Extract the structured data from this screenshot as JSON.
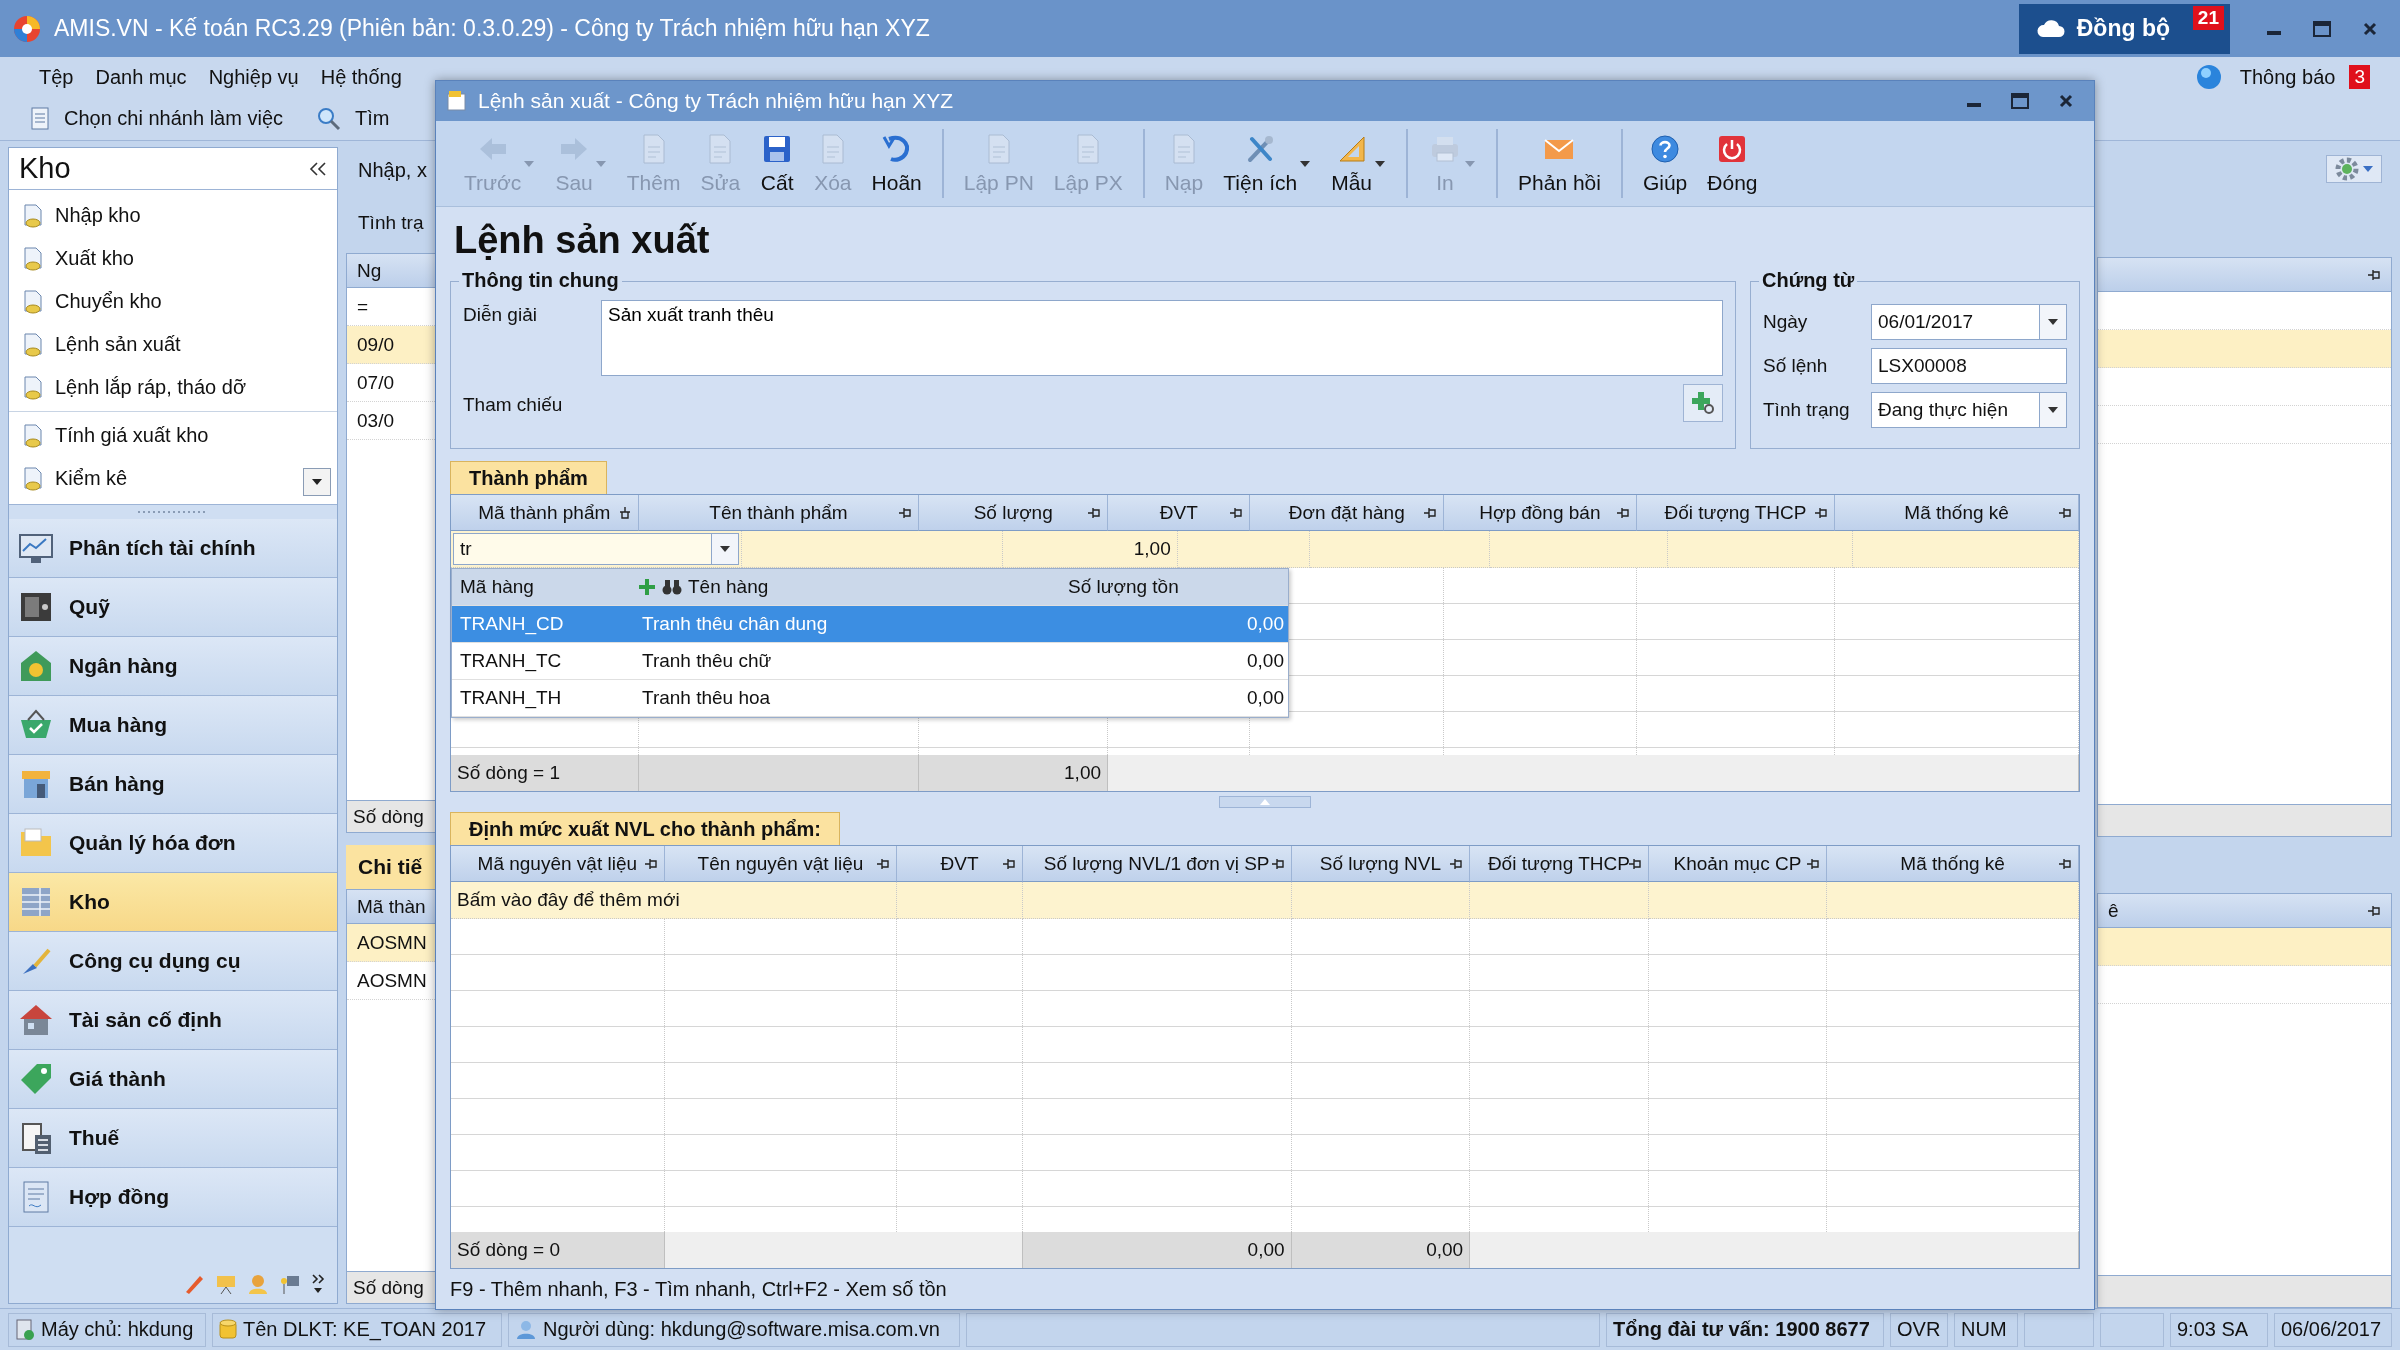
{
  "app": {
    "title": "AMIS.VN - Kế toán RC3.29 (Phiên bản: 0.3.0.29) - Công ty Trách nhiệm hữu hạn XYZ",
    "sync": {
      "label": "Đồng bộ",
      "count": "21"
    }
  },
  "menu": [
    "Tệp",
    "Danh mục",
    "Nghiệp vụ",
    "Hệ thống"
  ],
  "notice": {
    "label": "Thông báo",
    "count": "3"
  },
  "toolbar": [
    {
      "label": "Chọn chi nhánh làm việc",
      "kind": "branch"
    },
    {
      "label": "Tìm",
      "kind": "search"
    }
  ],
  "sidebar": {
    "title": "Kho",
    "item_groups": [
      [
        "Nhập kho",
        "Xuất kho",
        "Chuyển kho",
        "Lệnh sản xuất",
        "Lệnh lắp ráp, tháo dỡ"
      ],
      [
        "Tính giá xuất kho",
        "Kiểm kê"
      ]
    ],
    "modules": [
      {
        "label": "Phân tích tài chính",
        "kind": "chart",
        "selected": false
      },
      {
        "label": "Quỹ",
        "kind": "safe",
        "selected": false
      },
      {
        "label": "Ngân hàng",
        "kind": "bank",
        "selected": false
      },
      {
        "label": "Mua hàng",
        "kind": "cart",
        "selected": false
      },
      {
        "label": "Bán hàng",
        "kind": "shop",
        "selected": false
      },
      {
        "label": "Quản lý hóa đơn",
        "kind": "folder",
        "selected": false
      },
      {
        "label": "Kho",
        "kind": "warehouse",
        "selected": true
      },
      {
        "label": "Công cụ dụng cụ",
        "kind": "tool",
        "selected": false
      },
      {
        "label": "Tài sản cố định",
        "kind": "house",
        "selected": false
      },
      {
        "label": "Giá thành",
        "kind": "tag",
        "selected": false
      },
      {
        "label": "Thuế",
        "kind": "calculator",
        "selected": false
      },
      {
        "label": "Hợp đồng",
        "kind": "contract",
        "selected": false
      }
    ]
  },
  "background": {
    "tab": "Nhập, x",
    "status_label": "Tình trạ",
    "list_header": "Ng",
    "filter": "=",
    "list_rows": [
      {
        "text": "09/0",
        "selected": true
      },
      {
        "text": "07/0",
        "selected": false
      },
      {
        "text": "03/0",
        "selected": false
      }
    ],
    "list_footer": "Số dòng",
    "detail_tab": "Chi tiế",
    "detail_header": "Mã thàn",
    "detail_rows": [
      {
        "text": "AOSMN",
        "selected": true
      },
      {
        "text": "AOSMN",
        "selected": false
      }
    ],
    "detail_footer": "Số dòng",
    "right_detail_header": "ê"
  },
  "dialog": {
    "title": "Lệnh sản xuất - Công ty Trách nhiệm hữu hạn XYZ",
    "toolbar_groups": [
      [
        {
          "label": "Trước",
          "kind": "back",
          "disabled": true,
          "dropdown": true
        },
        {
          "label": "Sau",
          "kind": "forward",
          "disabled": true,
          "dropdown": true
        },
        {
          "label": "Thêm",
          "kind": "page",
          "disabled": true,
          "dropdown": false
        },
        {
          "label": "Sửa",
          "kind": "page",
          "disabled": true,
          "dropdown": false
        },
        {
          "label": "Cất",
          "kind": "save",
          "disabled": false,
          "dropdown": false
        },
        {
          "label": "Xóa",
          "kind": "page",
          "disabled": true,
          "dropdown": false
        },
        {
          "label": "Hoãn",
          "kind": "undo",
          "disabled": false,
          "dropdown": false
        }
      ],
      [
        {
          "label": "Lập PN",
          "kind": "page",
          "disabled": true,
          "dropdown": false
        },
        {
          "label": "Lập PX",
          "kind": "page",
          "disabled": true,
          "dropdown": false
        }
      ],
      [
        {
          "label": "Nạp",
          "kind": "page",
          "disabled": true,
          "dropdown": false
        },
        {
          "label": "Tiện ích",
          "kind": "tools",
          "disabled": false,
          "dropdown": true
        },
        {
          "label": "Mẫu",
          "kind": "ruler",
          "disabled": false,
          "dropdown": true
        }
      ],
      [
        {
          "label": "In",
          "kind": "print",
          "disabled": true,
          "dropdown": true
        }
      ],
      [
        {
          "label": "Phản hồi",
          "kind": "mail",
          "disabled": false,
          "dropdown": false
        }
      ],
      [
        {
          "label": "Giúp",
          "kind": "help",
          "disabled": false,
          "dropdown": false
        },
        {
          "label": "Đóng",
          "kind": "power",
          "disabled": false,
          "dropdown": false
        }
      ]
    ],
    "heading": "Lệnh sản xuất",
    "general": {
      "legend": "Thông tin chung",
      "description_label": "Diễn giải",
      "description": "Sản xuất tranh thêu",
      "reference_label": "Tham chiếu"
    },
    "voucher": {
      "legend": "Chứng từ",
      "fields": [
        {
          "label": "Ngày",
          "value": "06/01/2017",
          "kind": "combo"
        },
        {
          "label": "Số lệnh",
          "value": "LSX00008",
          "kind": "text"
        },
        {
          "label": "Tình trạng",
          "value": "Đang thực hiện",
          "kind": "combo"
        }
      ]
    },
    "products": {
      "tab": "Thành phẩm",
      "columns": [
        {
          "label": "Mã thành phẩm",
          "pinned": true
        },
        {
          "label": "Tên thành phẩm",
          "pinned": false
        },
        {
          "label": "Số lượng",
          "pinned": false
        },
        {
          "label": "ĐVT",
          "pinned": false
        },
        {
          "label": "Đơn đặt hàng",
          "pinned": false
        },
        {
          "label": "Hợp đồng bán",
          "pinned": false
        },
        {
          "label": "Đối tượng THCP",
          "pinned": false
        },
        {
          "label": "Mã thống kê",
          "pinned": false
        }
      ],
      "edit_row": {
        "code": "tr",
        "quantity": "1,00"
      },
      "lookup": {
        "columns": [
          "Mã hàng",
          "Tên hàng",
          "Số lượng tồn"
        ],
        "rows": [
          {
            "code": "TRANH_CD",
            "name": "Tranh thêu chân dung",
            "stock": "0,00",
            "selected": true
          },
          {
            "code": "TRANH_TC",
            "name": "Tranh thêu chữ",
            "stock": "0,00",
            "selected": false
          },
          {
            "code": "TRANH_TH",
            "name": "Tranh thêu hoa",
            "stock": "0,00",
            "selected": false
          }
        ]
      },
      "footer": {
        "count": "Số dòng = 1",
        "quantity": "1,00"
      }
    },
    "materials": {
      "tab": "Định mức xuất NVL cho thành phẩm:",
      "columns": [
        {
          "label": "Mã nguyên vật liệu",
          "pinned": false
        },
        {
          "label": "Tên nguyên vật liệu",
          "pinned": false
        },
        {
          "label": "ĐVT",
          "pinned": false
        },
        {
          "label": "Số lượng NVL/1 đơn vị SP",
          "pinned": false
        },
        {
          "label": "Số lượng NVL",
          "pinned": false
        },
        {
          "label": "Đối tượng THCP",
          "pinned": false
        },
        {
          "label": "Khoản mục CP",
          "pinned": false
        },
        {
          "label": "Mã thống kê",
          "pinned": false
        }
      ],
      "new_row": "Bấm vào đây để thêm mới",
      "footer": {
        "count": "Số dòng = 0",
        "per_unit": "0,00",
        "total": "0,00"
      }
    },
    "hint": "F9 - Thêm nhanh, F3 - Tìm nhanh, Ctrl+F2 - Xem số tồn"
  },
  "status_bar": [
    {
      "text": "Máy chủ: hkdung",
      "kind": "server"
    },
    {
      "text": "Tên DLKT: KE_TOAN 2017",
      "kind": "database"
    },
    {
      "text": "Người dùng: hkdung@software.misa.com.vn",
      "kind": "user"
    },
    {
      "kind": "blank"
    },
    {
      "text": "Tổng đài tư vấn: 1900 8677",
      "kind": "hotline"
    },
    {
      "text": "OVR",
      "kind": "plain"
    },
    {
      "text": "NUM",
      "kind": "plain"
    },
    {
      "kind": "blank"
    },
    {
      "kind": "blank"
    },
    {
      "text": "9:03 SA",
      "kind": "plain"
    },
    {
      "text": "06/06/2017",
      "kind": "plain"
    }
  ]
}
